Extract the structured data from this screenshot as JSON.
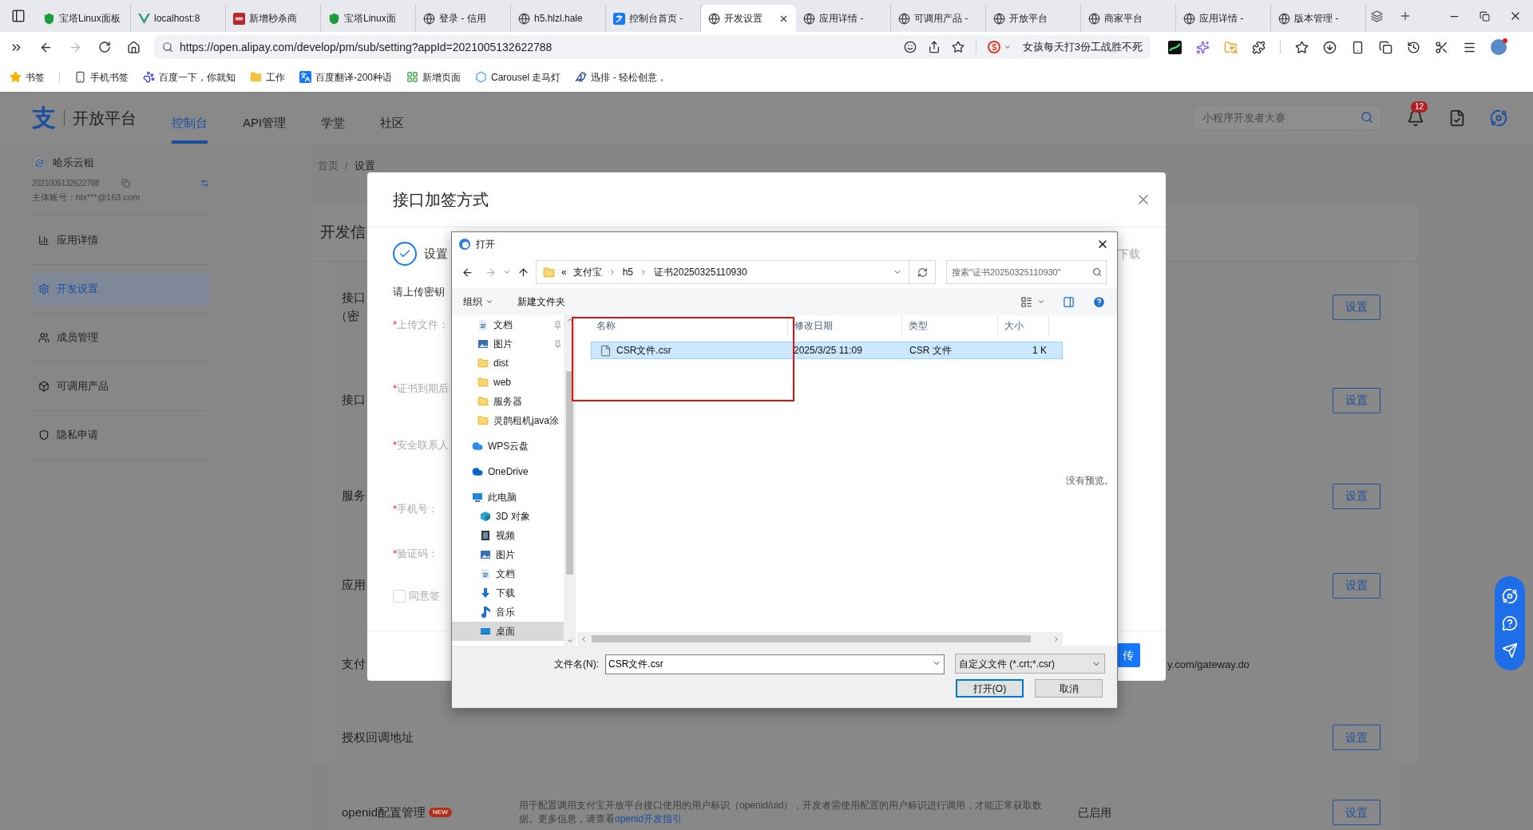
{
  "browser": {
    "tabs": [
      {
        "title": "宝塔Linux面板",
        "kind": "shield",
        "selected": false
      },
      {
        "title": "localhost:8",
        "kind": "vue",
        "selected": false
      },
      {
        "title": "新增秒杀商",
        "kind": "red",
        "selected": false
      },
      {
        "title": "宝塔Linux面",
        "kind": "shield",
        "selected": false
      },
      {
        "title": "登录 - 信用",
        "kind": "globe",
        "selected": false
      },
      {
        "title": "h5.hlzl.hale",
        "kind": "globe",
        "selected": false
      },
      {
        "title": "控制台首页 -",
        "kind": "alipay",
        "selected": false
      },
      {
        "title": "开发设置",
        "kind": "globe",
        "selected": true
      },
      {
        "title": "应用详情 -",
        "kind": "globe",
        "selected": false
      },
      {
        "title": "可调用产品 -",
        "kind": "globe",
        "selected": false
      },
      {
        "title": "开放平台",
        "kind": "globe",
        "selected": false
      },
      {
        "title": "商家平台",
        "kind": "globe",
        "selected": false
      },
      {
        "title": "应用详情 -",
        "kind": "globe",
        "selected": false
      },
      {
        "title": "版本管理 -",
        "kind": "globe",
        "selected": false
      }
    ],
    "url": "https://open.alipay.com/develop/pm/sub/setting?appId=2021005132622788",
    "search_suggestion": "女孩每天打3份工战胜不死",
    "bookmarks": [
      {
        "label": "书签",
        "kind": "star"
      },
      {
        "label": "手机书签",
        "kind": "phone"
      },
      {
        "label": "百度一下，你就知",
        "kind": "paw"
      },
      {
        "label": "工作",
        "kind": "folder"
      },
      {
        "label": "百度翻译-200种语",
        "kind": "translate"
      },
      {
        "label": "新增页面",
        "kind": "grid"
      },
      {
        "label": "Carousel 走马灯",
        "kind": "hexagon"
      },
      {
        "label": "迅排 - 轻松创意，",
        "kind": "bird"
      }
    ]
  },
  "site_header": {
    "logo_mark": "支",
    "name": "开放平台",
    "nav": [
      {
        "label": "控制台",
        "selected": true
      },
      {
        "label": "API管理",
        "selected": false
      },
      {
        "label": "学堂",
        "selected": false
      },
      {
        "label": "社区",
        "selected": false
      }
    ],
    "search_placeholder": "小程序开发者大赛",
    "notification_count": "12"
  },
  "sidebar": {
    "app_name": "哈乐云租",
    "app_id": "2021005132622788",
    "account": "主体账号：hlx***@163.com",
    "menu": [
      {
        "label": "应用详情",
        "kind": "chart",
        "selected": false
      },
      {
        "label": "开发设置",
        "kind": "settings",
        "selected": true
      },
      {
        "label": "成员管理",
        "kind": "users",
        "selected": false
      },
      {
        "label": "可调用产品",
        "kind": "box",
        "selected": false
      },
      {
        "label": "隐私申请",
        "kind": "shield",
        "selected": false
      }
    ]
  },
  "breadcrumb": {
    "items": [
      "首页",
      "设置"
    ],
    "separator": "/"
  },
  "settings_card": {
    "title": "开发信",
    "rows": [
      {
        "label": [
          "接口",
          "（密"
        ],
        "button": "设置"
      },
      {
        "label": [
          "接口"
        ],
        "button": "设置"
      },
      {
        "label": [
          "服务"
        ],
        "button": "设置"
      },
      {
        "label": [
          "应用"
        ],
        "button": "设置"
      },
      {
        "label": [
          "支付"
        ],
        "value": "y.com/gateway.do"
      },
      {
        "label": [
          "授权回调地址"
        ],
        "button": "设置"
      },
      {
        "label": [
          "openid配置管理"
        ],
        "badge": "NEW",
        "description": "用于配置调用支付宝开放平台接口使用的用户标识（openid/uid），开发者需使用配置的用户标识进行调用，才能正常获取数据。更多信息，请查看",
        "link": "openid开发指引",
        "status": "已启用",
        "button": "设置"
      }
    ]
  },
  "modal": {
    "title": "接口加签方式",
    "step": "设置",
    "step_right": "下载",
    "instruction": "请上传密钥",
    "required_mark": "*",
    "fields": [
      {
        "label": "上传文件：",
        "required": true
      },
      {
        "label": "证书到期后",
        "required": true
      },
      {
        "label": "安全联系人",
        "required": true
      },
      {
        "label": "手机号：",
        "required": true
      },
      {
        "label": "验证码：",
        "required": true
      }
    ],
    "agreement": {
      "label": "同意签",
      "checked": false
    },
    "submit": "传"
  },
  "file_dialog": {
    "title": "打开",
    "path_overflow": "«",
    "path": [
      "支付宝",
      "h5",
      "证书20250325110930"
    ],
    "search_placeholder": "搜索\"证书20250325110930\"",
    "toolbar": {
      "organize": "组织",
      "new_folder": "新建文件夹"
    },
    "nav_pane": [
      {
        "kind": "group",
        "children": [
          {
            "label": "文档",
            "kind": "doc",
            "pinned": true,
            "selected": false
          },
          {
            "label": "图片",
            "kind": "image",
            "pinned": true,
            "selected": false
          },
          {
            "label": "dist",
            "kind": "folder",
            "pinned": false,
            "selected": false
          },
          {
            "label": "web",
            "kind": "folder",
            "pinned": false,
            "selected": false
          },
          {
            "label": "服务器",
            "kind": "folder",
            "pinned": false,
            "selected": false
          },
          {
            "label": "灵鹊租机java涂",
            "kind": "folder",
            "pinned": false,
            "selected": false
          }
        ]
      },
      {
        "label": "WPS云盘",
        "kind": "cloud",
        "selected": false
      },
      {
        "label": "OneDrive",
        "kind": "onedrive",
        "selected": false
      },
      {
        "label": "此电脑",
        "kind": "pc",
        "selected": false,
        "children": [
          {
            "label": "3D 对象",
            "kind": "cube",
            "selected": false
          },
          {
            "label": "视频",
            "kind": "video",
            "selected": false
          },
          {
            "label": "图片",
            "kind": "image",
            "selected": false
          },
          {
            "label": "文档",
            "kind": "doc",
            "selected": false
          },
          {
            "label": "下载",
            "kind": "download",
            "selected": false
          },
          {
            "label": "音乐",
            "kind": "music",
            "selected": false
          },
          {
            "label": "桌面",
            "kind": "desktop",
            "selected": true
          }
        ]
      }
    ],
    "columns": [
      "名称",
      "修改日期",
      "类型",
      "大小"
    ],
    "files": [
      {
        "name": "CSR文件.csr",
        "modified": "2025/3/25 11:09",
        "type": "CSR 文件",
        "size": "1 K",
        "selected": true
      }
    ],
    "preview_text": "没有预览。",
    "filename_label": "文件名(N):",
    "filename": "CSR文件.csr",
    "filter": "自定义文件 (*.crt;*.csr)",
    "buttons": [
      "打开(O)",
      "取消"
    ]
  }
}
